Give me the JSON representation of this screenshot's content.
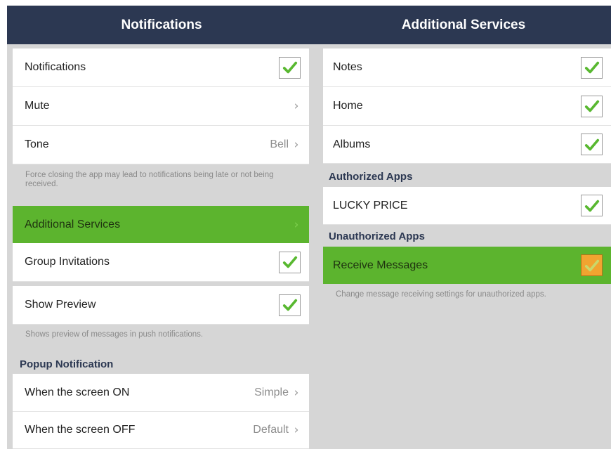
{
  "left": {
    "title": "Notifications",
    "rows": [
      {
        "label": "Notifications",
        "checked": true
      },
      {
        "label": "Mute",
        "chevron": "›"
      },
      {
        "label": "Tone",
        "value": "Bell",
        "chevron": "›"
      },
      {
        "label": "Additional Services",
        "chevron": "›",
        "highlighted": true
      },
      {
        "label": "Group Invitations",
        "checked": true
      },
      {
        "label": "Show Preview",
        "checked": true
      },
      {
        "label": "When the screen ON",
        "value": "Simple",
        "chevron": "›"
      },
      {
        "label": "When the screen OFF",
        "value": "Default",
        "chevron": "›"
      }
    ],
    "note_force_close": "Force closing the app may lead to notifications being late or not being received.",
    "note_preview": "Shows preview of messages in push notifications.",
    "section_popup": "Popup Notification"
  },
  "right": {
    "title": "Additional Services",
    "rows": [
      {
        "label": "Notes",
        "checked": true
      },
      {
        "label": "Home",
        "checked": true
      },
      {
        "label": "Albums",
        "checked": true
      },
      {
        "label": "LUCKY PRICE",
        "checked": true
      },
      {
        "label": "Receive Messages",
        "checked": true,
        "highlighted": true
      }
    ],
    "section_authorized": "Authorized Apps",
    "section_unauthorized": "Unauthorized Apps",
    "note_unauthorized": "Change message receiving settings for unauthorized apps."
  },
  "colors": {
    "header": "#2c3852",
    "highlight": "#5cb42e",
    "check": "#58b830",
    "check_orange": "#f1a430",
    "panel_bg": "#d6d6d6"
  },
  "icons": {
    "check": "check-icon",
    "chevron": "chevron-right-icon"
  }
}
